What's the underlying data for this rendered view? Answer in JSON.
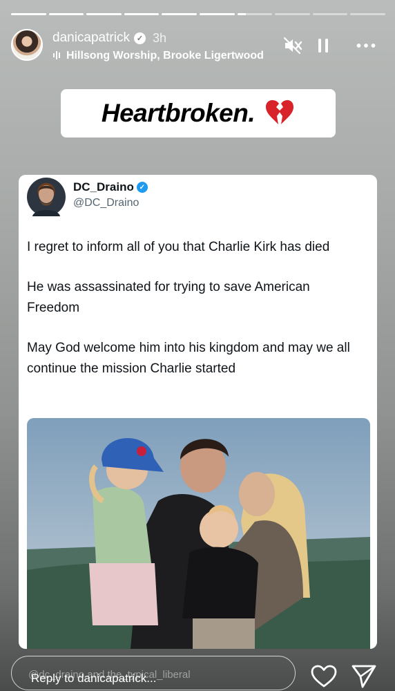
{
  "story": {
    "progress_segments": [
      1,
      1,
      1,
      1,
      1,
      1,
      0.25,
      0,
      0,
      0
    ]
  },
  "header": {
    "username": "danicapatrick",
    "time": "3h",
    "music": "Hillsong Worship, Brooke Ligertwood"
  },
  "caption": {
    "text": "Heartbroken.",
    "emoji": "💔"
  },
  "tweet": {
    "name": "DC_Draino",
    "handle": "@DC_Draino",
    "paragraphs": [
      "I regret to inform all of you that Charlie Kirk has died",
      "He was assassinated for trying to save American Freedom",
      "May God welcome him into his kingdom and may we all continue the mission Charlie started"
    ]
  },
  "footer": {
    "mention_hint": "@dc_draino and the_typical_liberal",
    "reply_placeholder": "Reply to danicapatrick..."
  },
  "icons": {
    "mute": "speaker-muted-icon",
    "pause": "pause-icon",
    "more": "more-dots-icon",
    "heart": "heart-icon",
    "send": "send-icon"
  },
  "colors": {
    "verified_blue": "#1d9bf0",
    "heart_red": "#e0245e"
  }
}
